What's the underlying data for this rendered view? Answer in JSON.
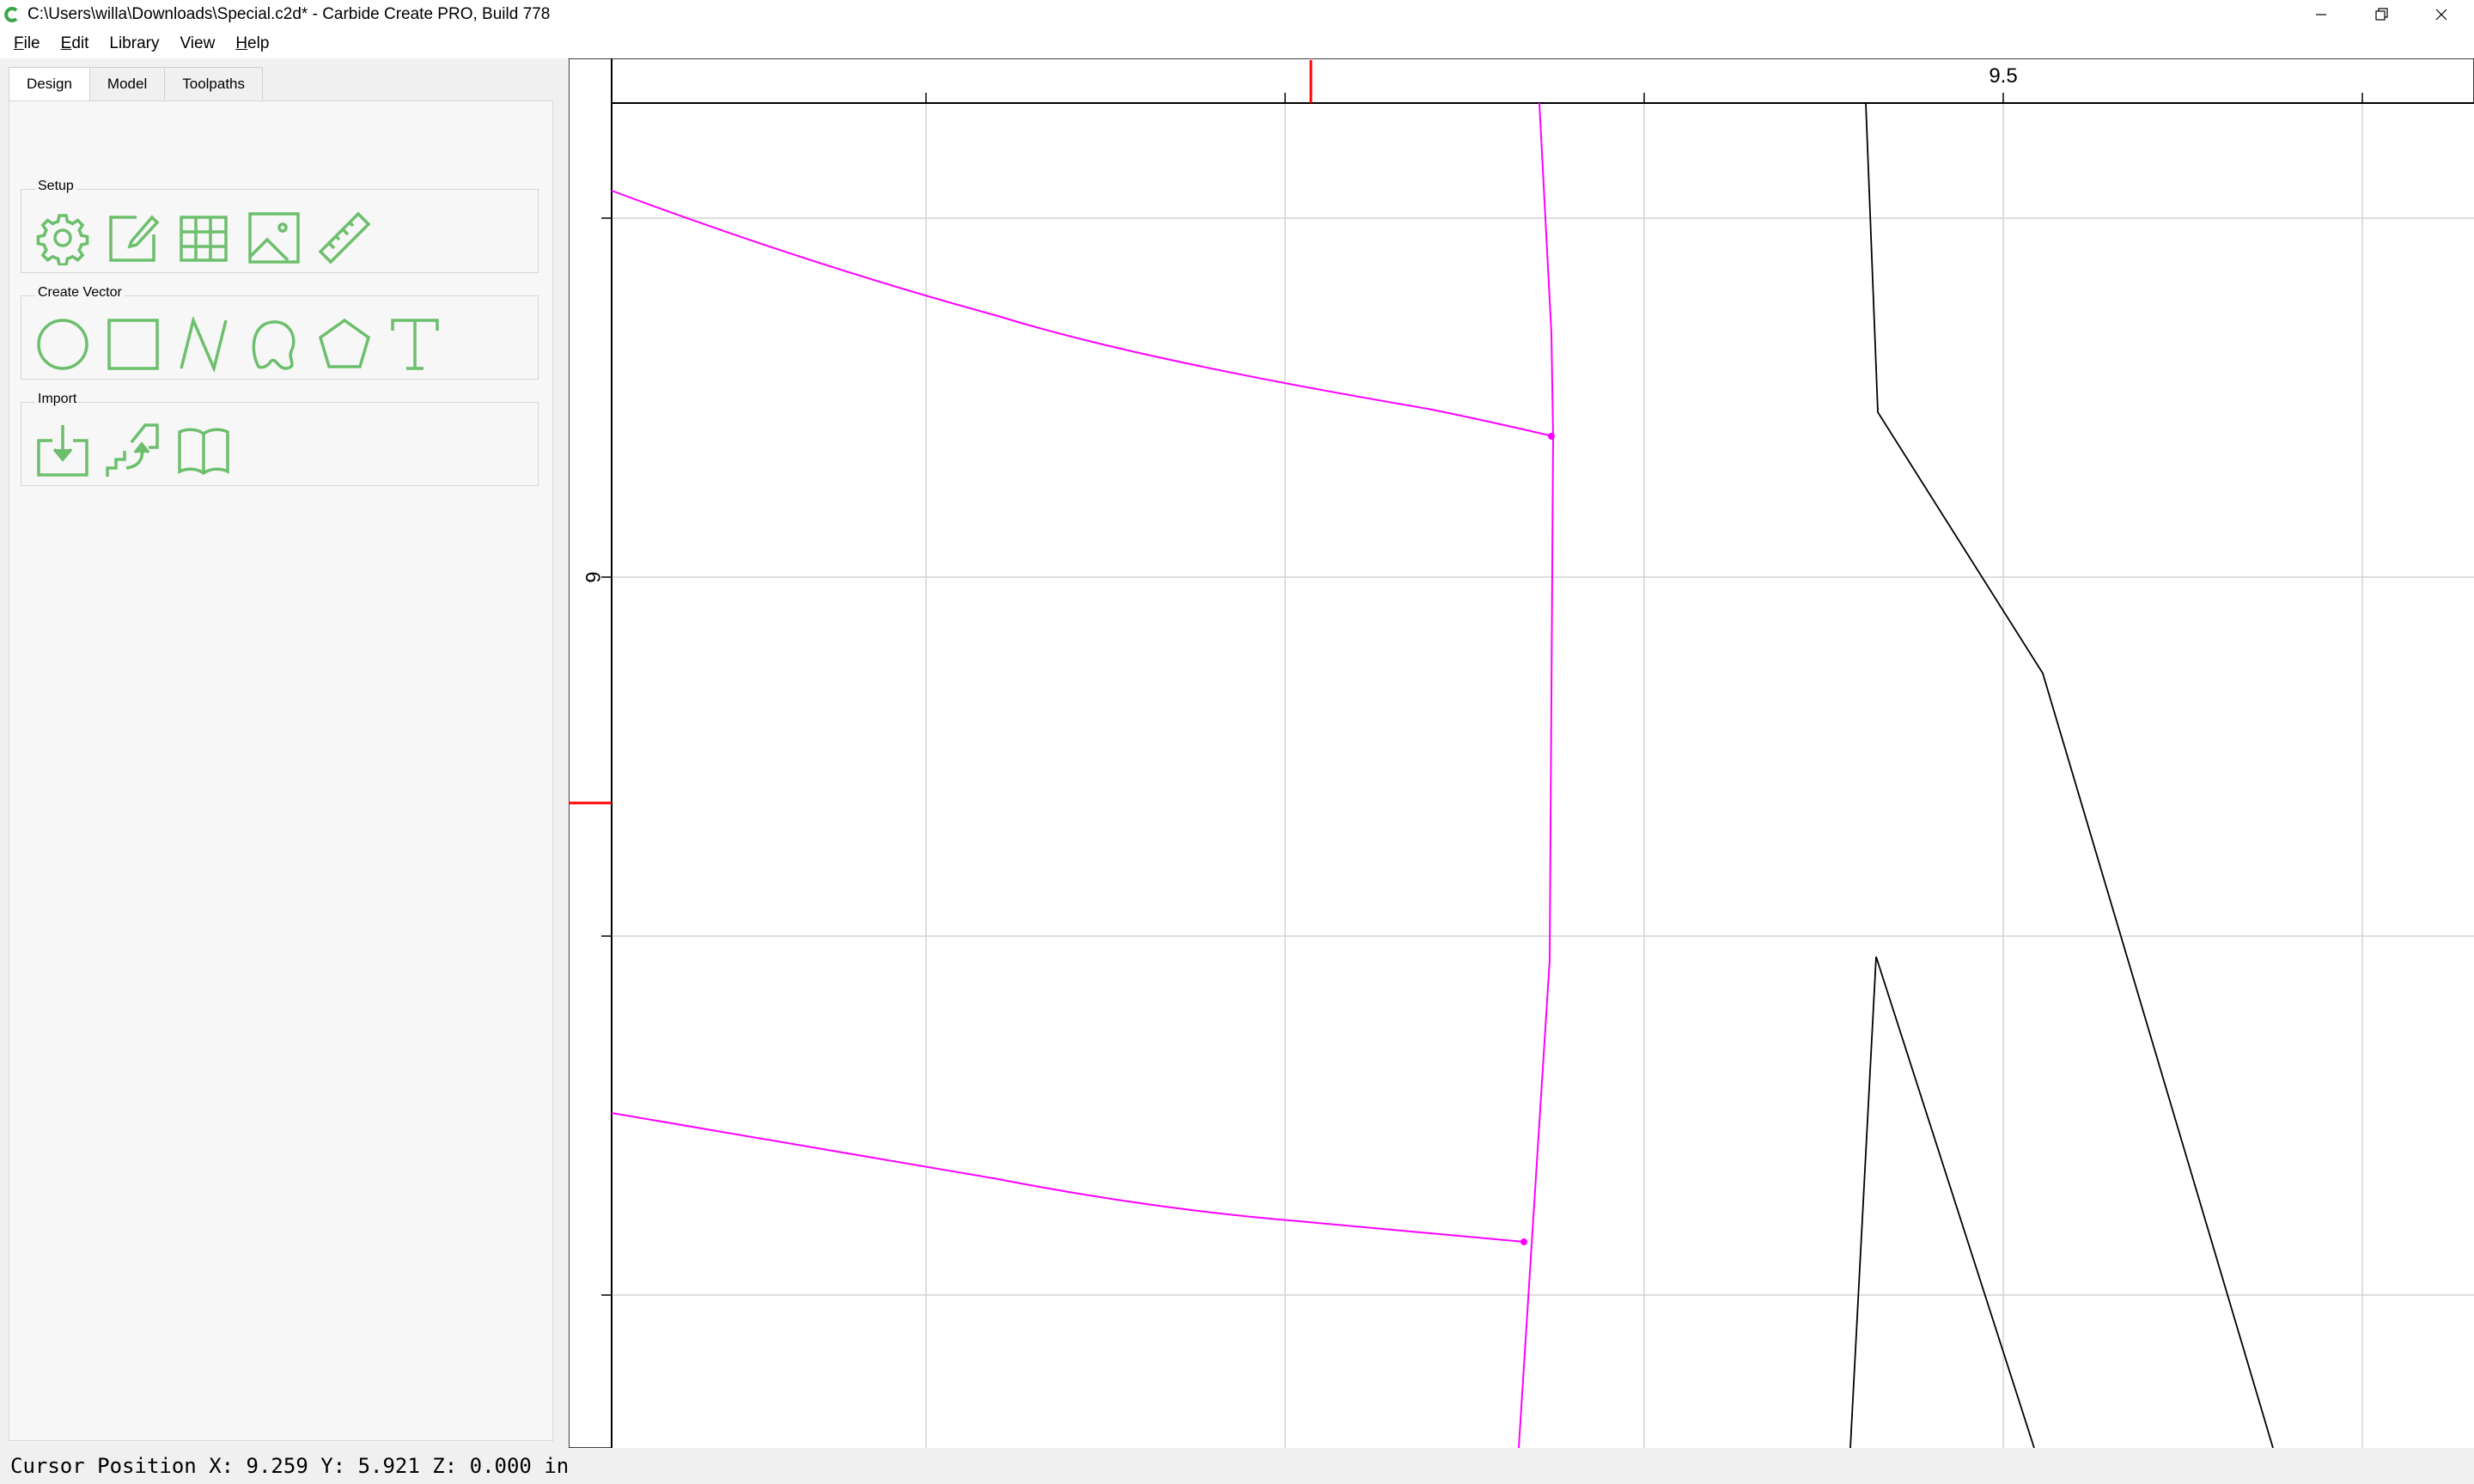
{
  "window": {
    "title": "C:\\Users\\willa\\Downloads\\Special.c2d* - Carbide Create PRO, Build 778",
    "app_icon": "carbide-c-icon",
    "controls": [
      "minimize-icon",
      "restore-icon",
      "close-icon"
    ]
  },
  "menubar": {
    "items": [
      {
        "label": "File",
        "mnemonic": "F"
      },
      {
        "label": "Edit",
        "mnemonic": "E"
      },
      {
        "label": "Library"
      },
      {
        "label": "View"
      },
      {
        "label": "Help",
        "mnemonic": "H"
      }
    ]
  },
  "tabs": [
    "Design",
    "Model",
    "Toolpaths"
  ],
  "active_tab": "Design",
  "groups": {
    "setup": {
      "title": "Setup",
      "tools": [
        "gear-icon",
        "edit-document-icon",
        "grid-icon",
        "image-icon",
        "ruler-icon"
      ]
    },
    "create_vector": {
      "title": "Create Vector",
      "tools": [
        "circle-icon",
        "rectangle-icon",
        "polyline-icon",
        "curve-icon",
        "polygon-icon",
        "text-icon"
      ]
    },
    "import": {
      "title": "Import",
      "tools": [
        "import-vectors-icon",
        "import-image-icon",
        "library-book-icon"
      ]
    }
  },
  "canvas": {
    "ruler_x_label": "9.5",
    "ruler_y_label": "6",
    "selected_color": "#ff00ff",
    "vector_color": "#000000",
    "grid_color": "#d4d4d4",
    "cursor_marker_color": "#ff0000"
  },
  "status": {
    "text": "Cursor Position X: 9.259 Y: 5.921 Z: 0.000 in"
  },
  "colors": {
    "accent": "#6cbf6c"
  }
}
